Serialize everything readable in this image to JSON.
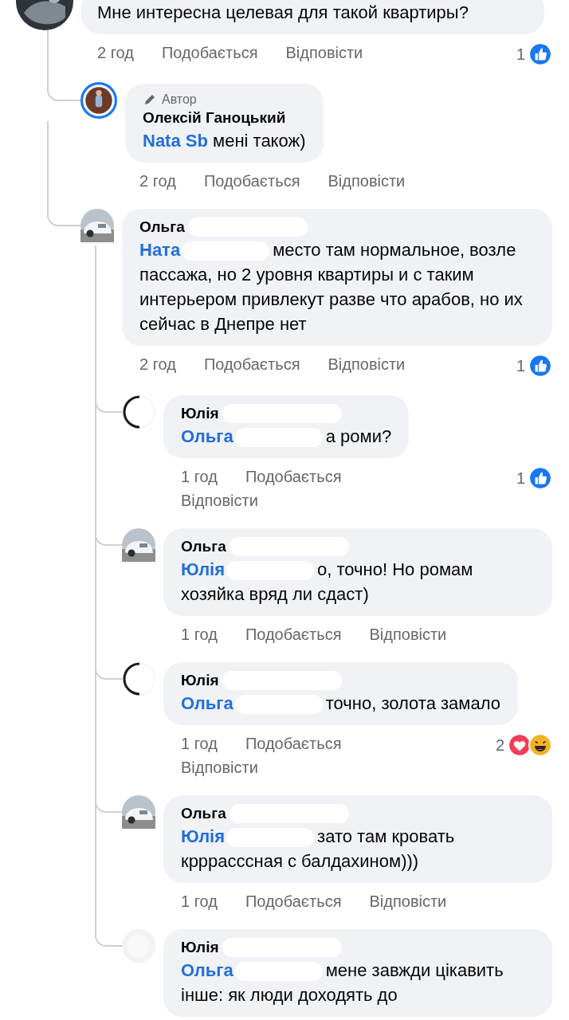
{
  "thread": {
    "comment": {
      "avatar": {
        "kind": "dark"
      },
      "text": "Мне интересна целевая для такой квартиры?",
      "time": "2 год",
      "like": "Подобається",
      "reply": "Відповісти",
      "reactions": {
        "count": "1",
        "icons": [
          {
            "kind": "like"
          }
        ]
      }
    },
    "replies": [
      {
        "avatar": {
          "kind": "author"
        },
        "badge": "Автор",
        "author": {
          "name": "Олексій Ганоцький",
          "redacted": false
        },
        "mention": {
          "name": "Nata Sb",
          "redacted": false
        },
        "text": "мені також)",
        "time": "2 год",
        "like": "Подобається",
        "reply": "Відповісти"
      },
      {
        "avatar": {
          "kind": "car"
        },
        "author": {
          "name": "Ольга",
          "redacted": true
        },
        "mention": {
          "name": "Ната",
          "redacted": true
        },
        "text": "место там нормальное, возле пассажа, но 2 уровня квартиры и с таким интерьером привлекут разве что арабов, но их сейчас в Днепре нет",
        "time": "2 год",
        "like": "Подобається",
        "reply": "Відповісти",
        "reactions": {
          "count": "1",
          "icons": [
            {
              "kind": "like"
            }
          ]
        },
        "replies": [
          {
            "avatar": {
              "kind": "ring"
            },
            "author": {
              "name": "Юлія",
              "redacted": true
            },
            "mention": {
              "name": "Ольга",
              "redacted": true
            },
            "text": "а роми?",
            "time": "1 год",
            "like": "Подобається",
            "reply": "Відповісти",
            "reactions": {
              "count": "1",
              "icons": [
                {
                  "kind": "like"
                }
              ]
            }
          },
          {
            "avatar": {
              "kind": "car"
            },
            "author": {
              "name": "Ольга",
              "redacted": true
            },
            "mention": {
              "name": "Юлія",
              "redacted": true
            },
            "text": "о, точно! Но ромам хозяйка вряд ли сдаст)",
            "time": "1 год",
            "like": "Подобається",
            "reply": "Відповісти"
          },
          {
            "avatar": {
              "kind": "ring"
            },
            "author": {
              "name": "Юлія",
              "redacted": true
            },
            "mention": {
              "name": "Ольга",
              "redacted": true
            },
            "text": "точно, золота замало",
            "time": "1 год",
            "like": "Подобається",
            "reply": "Відповісти",
            "reactions": {
              "count": "2",
              "icons": [
                {
                  "kind": "love"
                },
                {
                  "kind": "haha"
                }
              ]
            }
          },
          {
            "avatar": {
              "kind": "car"
            },
            "author": {
              "name": "Ольга",
              "redacted": true
            },
            "mention": {
              "name": "Юлія",
              "redacted": true
            },
            "text": "зато там кровать крррасссная с балдахином)))",
            "time": "1 год",
            "like": "Подобається",
            "reply": "Відповісти"
          },
          {
            "avatar": {
              "kind": "faint"
            },
            "author": {
              "name": "Юлія",
              "redacted": true
            },
            "mention": {
              "name": "Ольга",
              "redacted": true
            },
            "text": "мене завжди цікавить інше: як люди доходять до"
          }
        ]
      }
    ]
  }
}
